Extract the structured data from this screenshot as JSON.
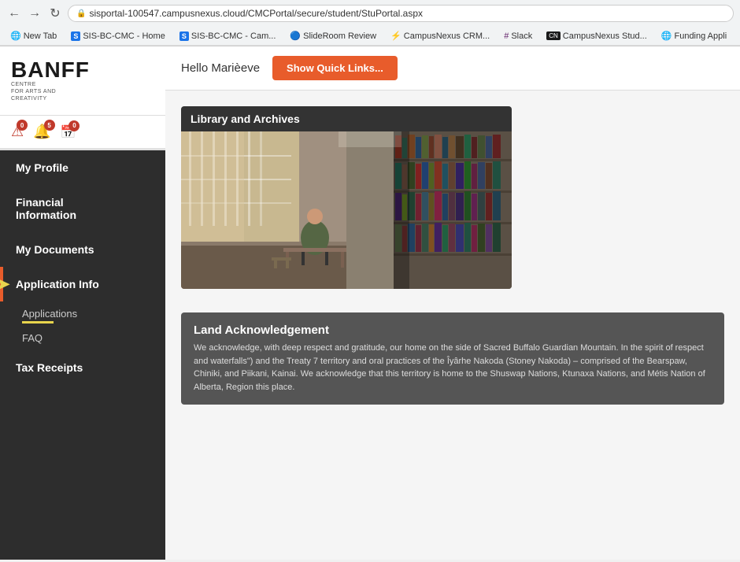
{
  "browser": {
    "url": "sisportal-100547.campusnexus.cloud/CMCPortal/secure/student/StuPortal.aspx",
    "back_title": "Back",
    "forward_title": "Forward",
    "refresh_title": "Refresh"
  },
  "bookmarks": [
    {
      "label": "New Tab",
      "icon": "globe",
      "color": "#4CAF50"
    },
    {
      "label": "SIS-BC-CMC - Home",
      "icon": "s",
      "color": "#1a73e8"
    },
    {
      "label": "SIS-BC-CMC - Cam...",
      "icon": "s",
      "color": "#1a73e8"
    },
    {
      "label": "SlideRoom Review",
      "icon": "circle",
      "color": "#e85c2b"
    },
    {
      "label": "CampusNexus CRM...",
      "icon": "cn",
      "color": "#e85c2b"
    },
    {
      "label": "Slack",
      "icon": "slack",
      "color": "#611f69"
    },
    {
      "label": "CampusNexus Stud...",
      "icon": "cn",
      "color": "#1a1a1a"
    },
    {
      "label": "Funding Appli",
      "icon": "globe",
      "color": "#4CAF50"
    }
  ],
  "logo": {
    "name": "BANFF",
    "subtitle": "CENTRE\nFOR ARTS AND\nCREATIVITY"
  },
  "notifications": [
    {
      "icon": "warning",
      "badge": "0",
      "color": "#c0392b"
    },
    {
      "icon": "bell",
      "badge": "5",
      "color": "#c0392b"
    },
    {
      "icon": "calendar",
      "badge": "0",
      "color": "#c0392b"
    }
  ],
  "sidebar": {
    "items": [
      {
        "label": "My Profile",
        "active": false,
        "id": "my-profile"
      },
      {
        "label": "Financial Information",
        "active": false,
        "id": "financial-info"
      },
      {
        "label": "My Documents",
        "active": false,
        "id": "my-documents"
      },
      {
        "label": "Application Info",
        "active": true,
        "id": "application-info"
      },
      {
        "label": "Tax Receipts",
        "active": false,
        "id": "tax-receipts"
      }
    ],
    "sub_items": [
      {
        "label": "Applications",
        "parent": "application-info",
        "has_underline": true
      },
      {
        "label": "FAQ",
        "parent": "application-info",
        "has_underline": false
      }
    ]
  },
  "header": {
    "greeting": "Hello Marièeve",
    "quick_links_label": "Show Quick Links..."
  },
  "main": {
    "library_card": {
      "title": "Library and Archives"
    },
    "land_acknowledgement": {
      "title": "Land Acknowledgement",
      "text": "We acknowledge, with deep respect and gratitude, our home on the side of Sacred Buffalo Guardian Mountain. In the spirit of respect and waterfalls\") and the Treaty 7 territory and oral practices of the Îyârhe Nakoda (Stoney Nakoda) – comprised of the Bearspaw, Chiniki, and Piikani, Kainai. We acknowledge that this territory is home to the Shuswap Nations, Ktunaxa Nations, and Métis Nation of Alberta, Region this place."
    }
  }
}
